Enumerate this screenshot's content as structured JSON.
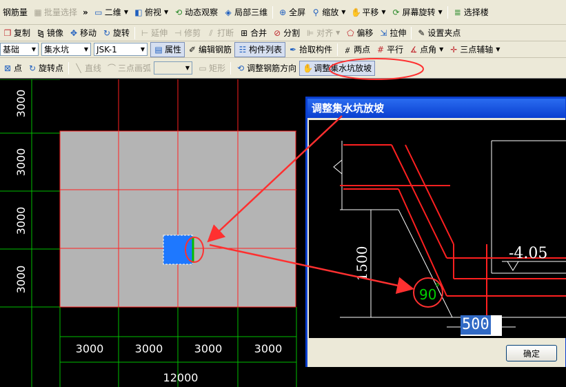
{
  "toolbar1": {
    "rebar_qty": "钢筋量",
    "batch_select": "批量选择",
    "view_2d": "二维",
    "view_top": "俯视",
    "orbit": "动态观察",
    "local_3d": "局部三维",
    "fullscreen": "全屏",
    "zoom": "缩放",
    "pan": "平移",
    "screen_rotate": "屏幕旋转",
    "select_floor": "选择楼"
  },
  "toolbar2": {
    "copy": "复制",
    "mirror": "镜像",
    "move": "移动",
    "rotate": "旋转",
    "extend": "延伸",
    "trim": "修剪",
    "break": "打断",
    "merge": "合并",
    "split": "分割",
    "align": "对齐",
    "offset": "偏移",
    "stretch": "拉伸",
    "set_grip": "设置夹点"
  },
  "toolbar3": {
    "layer": "基础",
    "component_type": "集水坑",
    "component_name": "JSK-1",
    "properties": "属性",
    "edit_rebar": "编辑钢筋",
    "component_list": "构件列表",
    "pick_component": "拾取构件",
    "two_points": "两点",
    "parallel": "平行",
    "point_angle": "点角",
    "three_point_axis": "三点辅轴"
  },
  "toolbar4": {
    "point": "点",
    "rotate_point": "旋转点",
    "line": "直线",
    "arc": "三点画弧",
    "rect": "矩形",
    "adjust_rebar_dir": "调整钢筋方向",
    "adjust_pit_slope": "调整集水坑放坡"
  },
  "canvas": {
    "row_dims": [
      "3000",
      "3000",
      "3000",
      "3000"
    ],
    "col_dims": [
      "3000",
      "3000",
      "3000",
      "3000"
    ],
    "total_dim": "12000"
  },
  "dialog": {
    "title": "调整集水坑放坡",
    "depth": "1500",
    "elevation": "-4.05",
    "angle": "90",
    "degree_mark": "°",
    "offset_value": "500",
    "ok": "确定"
  },
  "colors": {
    "toolbar_bg": "#ece9d8",
    "canvas_bg": "#000000",
    "slab": "#b4b4b4",
    "grid_red": "#ff2020",
    "grid_green": "#00c000",
    "pit_blue": "#1e78ff",
    "annotation_red": "#ff3030",
    "dialog_title": "#0a3fd0",
    "angle_green": "#00d000"
  }
}
